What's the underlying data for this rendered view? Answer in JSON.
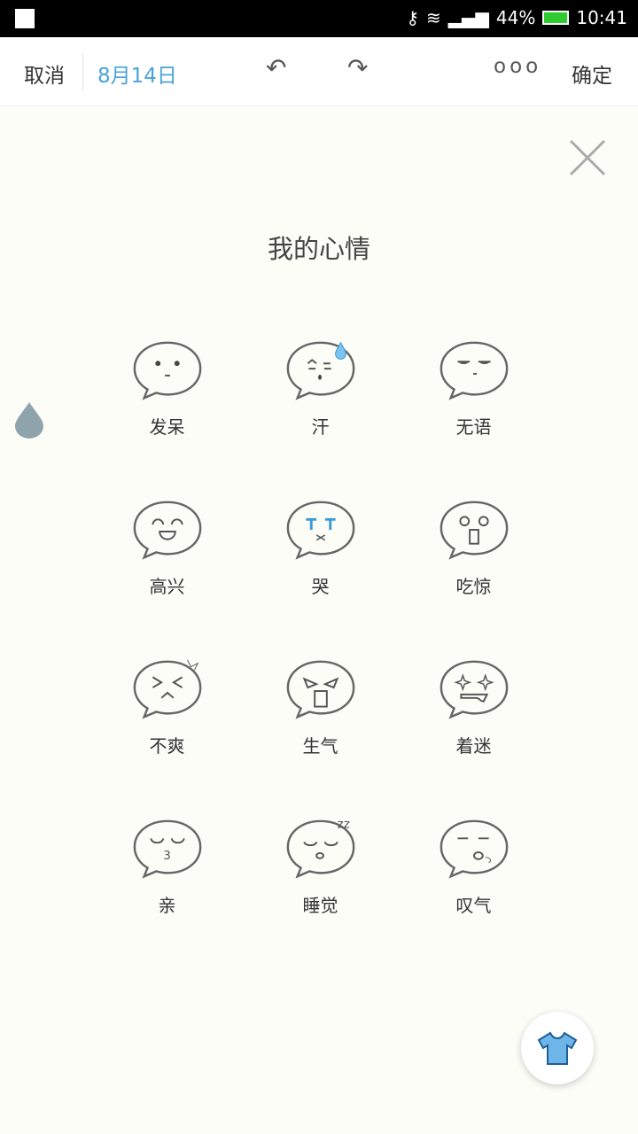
{
  "status_bar": {
    "battery": "44%",
    "time": "10:41",
    "battery_color": "#2ecc2e"
  },
  "toolbar": {
    "cancel": "取消",
    "date": "8月14日",
    "undo_icon": "↶",
    "redo_icon": "↷",
    "more_icon": "ooo",
    "confirm": "确定"
  },
  "panel": {
    "title": "我的心情",
    "moods": [
      {
        "label": "发呆",
        "icon": "blank"
      },
      {
        "label": "汗",
        "icon": "sweat"
      },
      {
        "label": "无语",
        "icon": "speechless"
      },
      {
        "label": "高兴",
        "icon": "happy"
      },
      {
        "label": "哭",
        "icon": "cry"
      },
      {
        "label": "吃惊",
        "icon": "surprised"
      },
      {
        "label": "不爽",
        "icon": "annoyed"
      },
      {
        "label": "生气",
        "icon": "angry"
      },
      {
        "label": "着迷",
        "icon": "fascinated"
      },
      {
        "label": "亲",
        "icon": "kiss"
      },
      {
        "label": "睡觉",
        "icon": "sleep"
      },
      {
        "label": "叹气",
        "icon": "sigh"
      }
    ]
  },
  "accent": "#4aa3d8"
}
